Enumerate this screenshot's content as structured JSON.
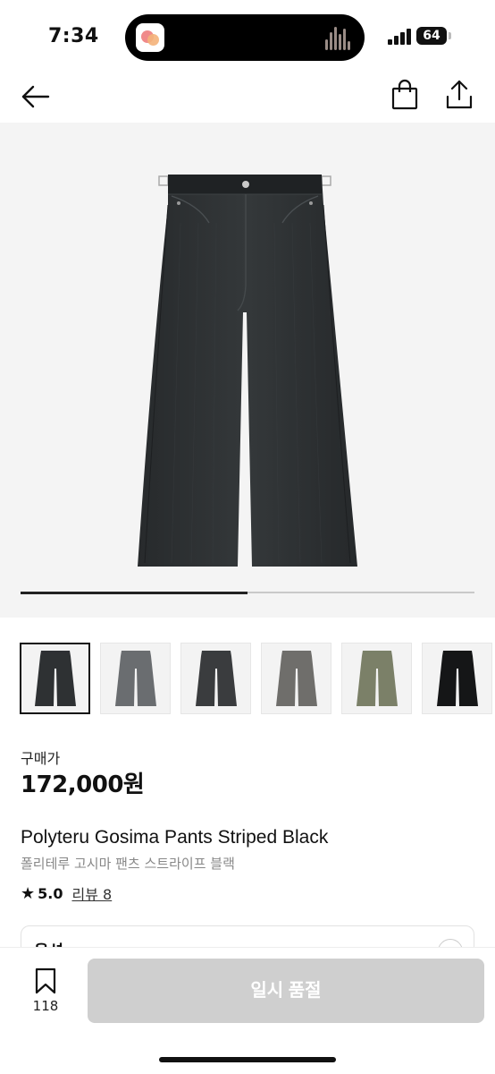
{
  "status_bar": {
    "time": "7:34",
    "battery": "64"
  },
  "product": {
    "price_label": "구매가",
    "price": "172,000원",
    "title_en": "Polyteru Gosima Pants Striped Black",
    "title_ko": "폴리테루 고시마 팬츠 스트라이프 블랙",
    "rating_score": "5.0",
    "review_label": "리뷰 8"
  },
  "gallery": {
    "progress": 0.5,
    "thumbnails": [
      {
        "name": "thumb-black-1",
        "color": "#2e3133"
      },
      {
        "name": "thumb-gray",
        "color": "#6a6d70"
      },
      {
        "name": "thumb-dark-wash",
        "color": "#3a3c3e"
      },
      {
        "name": "thumb-charcoal",
        "color": "#6f6e6b"
      },
      {
        "name": "thumb-olive",
        "color": "#7b8068"
      },
      {
        "name": "thumb-black-2",
        "color": "#151617"
      }
    ]
  },
  "options": {
    "label": "옵션"
  },
  "bottom_bar": {
    "wishlist_count": "118",
    "cta_label": "일시 품절"
  },
  "colors": {
    "accent": "#111111",
    "disabled": "#cfcfcf"
  }
}
